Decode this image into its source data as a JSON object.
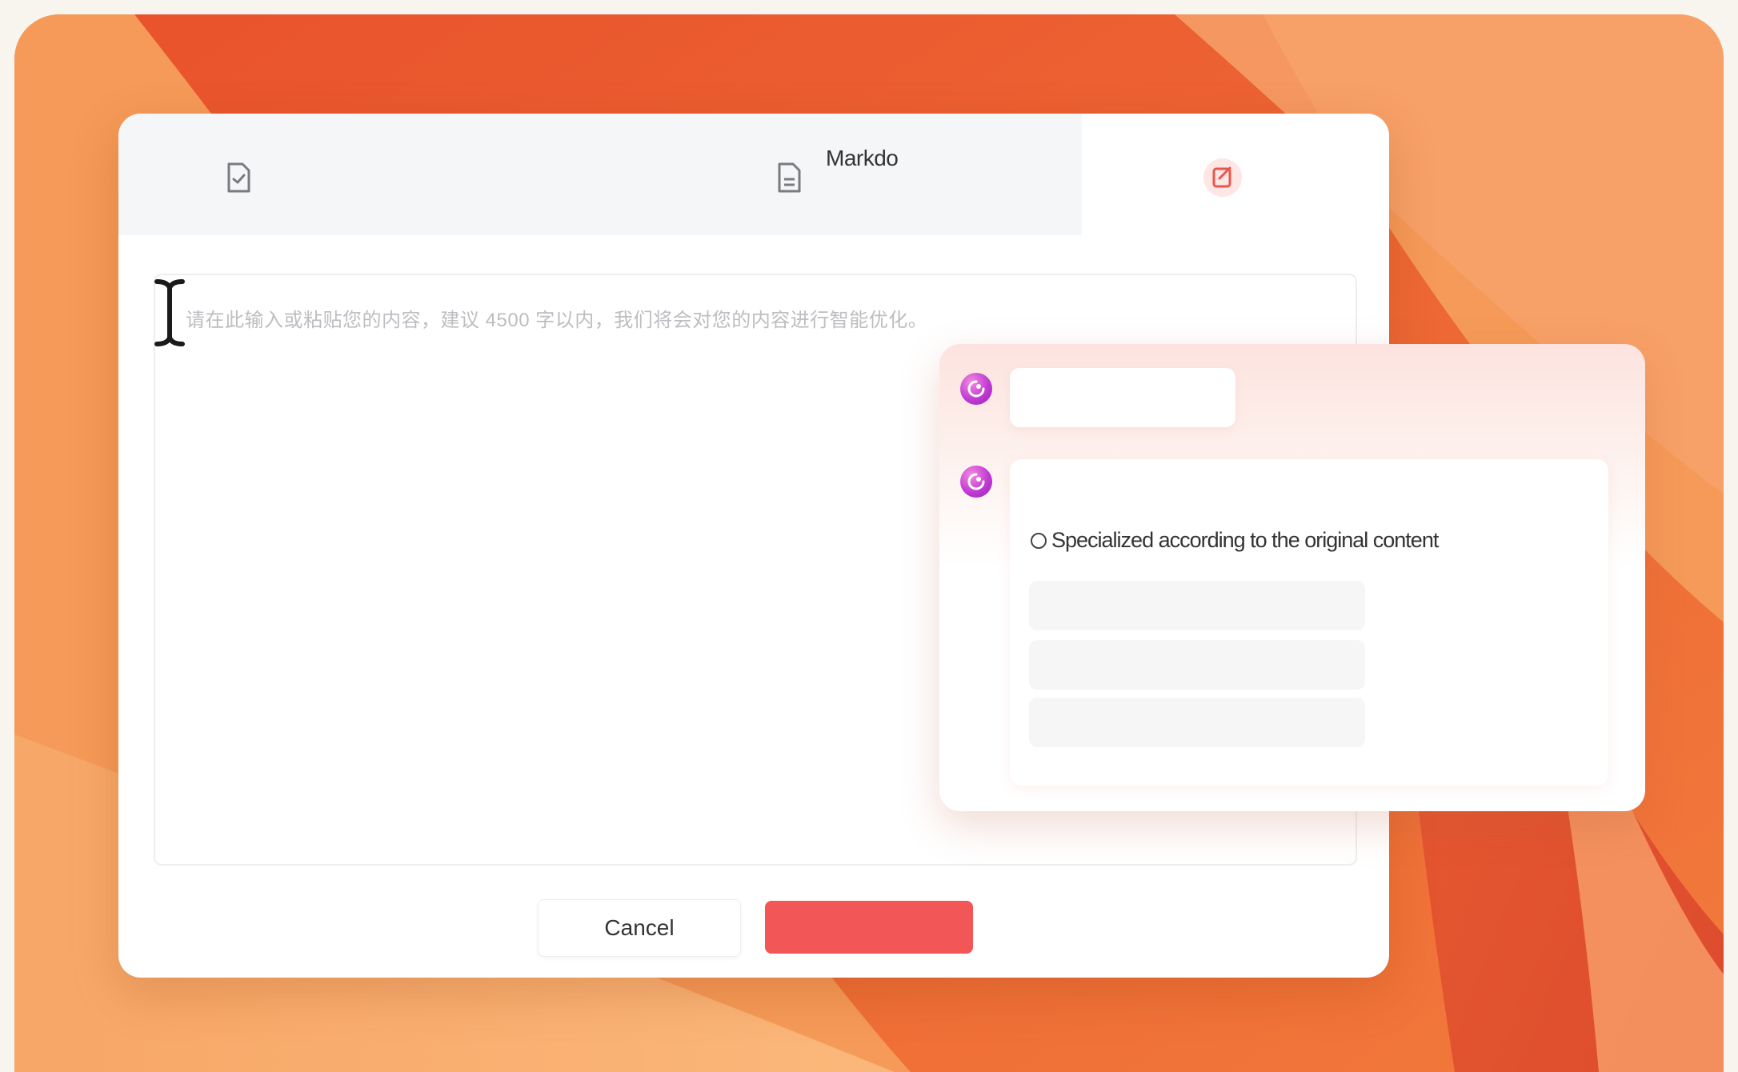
{
  "tabs": [
    {
      "icon": "document-icon",
      "label": ""
    },
    {
      "icon": "document-lines-icon",
      "label": "Markdo"
    },
    {
      "icon": "edit-icon",
      "label": "",
      "accent": "#e8574e"
    }
  ],
  "editor": {
    "placeholder": "请在此输入或粘贴您的内容，建议 4500 字以内，我们将会对您的内容进行智能优化。"
  },
  "buttons": {
    "cancel_label": "Cancel",
    "confirm_color": "#f25656"
  },
  "ai_panel": {
    "option_label": "Specialized according to the original content"
  },
  "colors": {
    "wallpaper_light": "#f7a865",
    "wallpaper_dark": "#e4542f",
    "avatar": "#c13bd4"
  }
}
